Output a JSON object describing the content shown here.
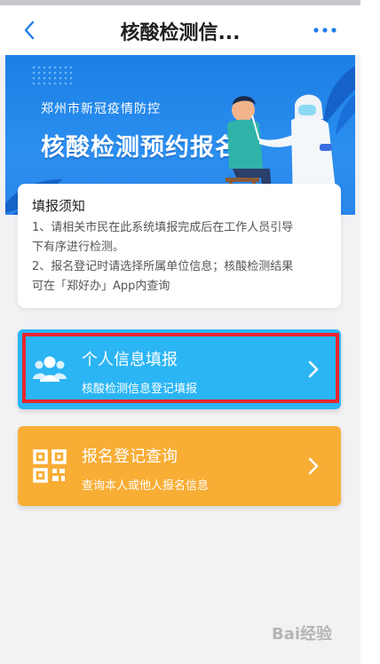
{
  "nav": {
    "title": "核酸检测信...",
    "back_icon": "chevron-left-icon",
    "more_icon": "more-dots-icon",
    "accent": "#1e7fe6"
  },
  "banner": {
    "subtitle": "郑州市新冠疫情防控",
    "title": "核酸检测预约报名"
  },
  "notice": {
    "heading": "填报须知",
    "lines": [
      "1、请相关市民在此系统填报完成后在工作人员引导",
      "下有序进行检测。",
      "2、报名登记时请选择所属单位信息；核酸检测结果",
      "可在「郑好办」App内查询"
    ]
  },
  "cards": [
    {
      "title": "个人信息填报",
      "desc": "核酸检测信息登记填报",
      "color": "#2bb5f4",
      "icon": "people-icon"
    },
    {
      "title": "报名登记查询",
      "desc": "查询本人或他人报名信息",
      "color": "#f8ad35",
      "icon": "qr-code-icon"
    }
  ],
  "watermark": {
    "text": "Bai经验"
  }
}
